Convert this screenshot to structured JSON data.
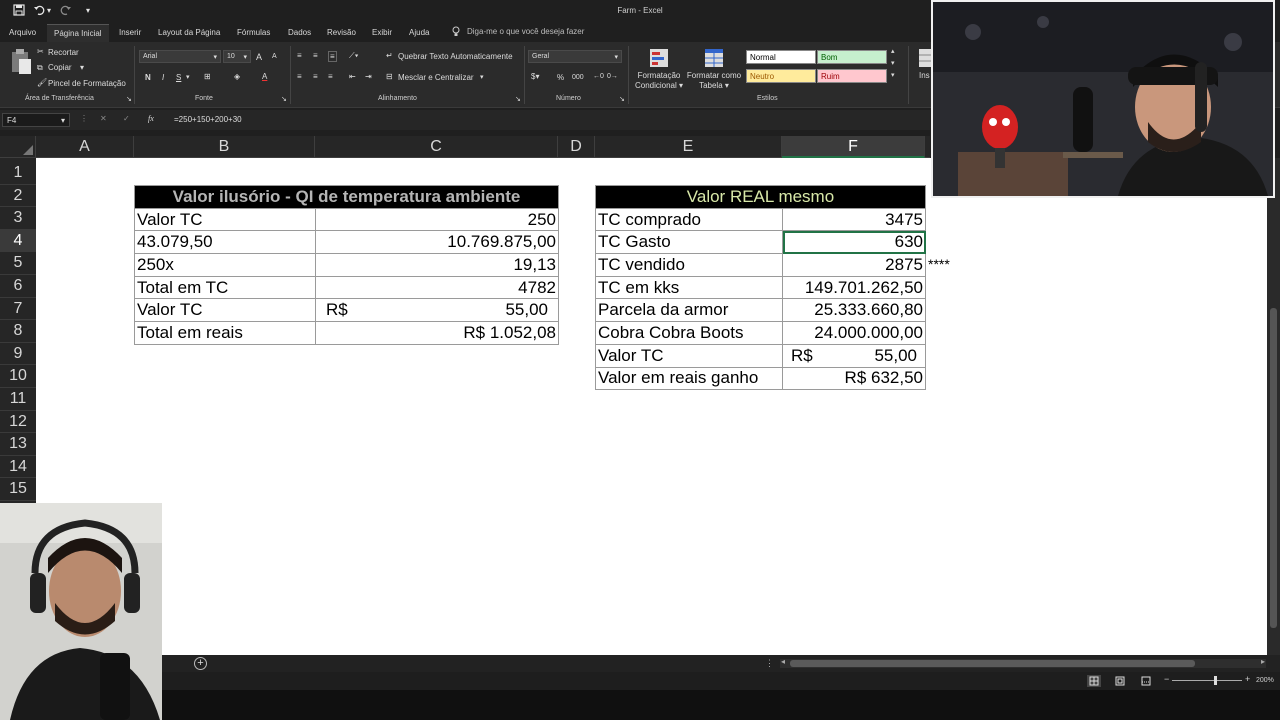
{
  "app": {
    "file_name": "Farm",
    "app_name": "Excel",
    "title": "Farm  -  Excel"
  },
  "quick_access": {
    "save_icon": "save-icon",
    "undo_icon": "undo-icon",
    "redo_icon": "redo-icon",
    "customize_icon": "customize-icon"
  },
  "tabs": [
    {
      "label": "Arquivo"
    },
    {
      "label": "Página Inicial",
      "active": true
    },
    {
      "label": "Inserir"
    },
    {
      "label": "Layout da Página"
    },
    {
      "label": "Fórmulas"
    },
    {
      "label": "Dados"
    },
    {
      "label": "Revisão"
    },
    {
      "label": "Exibir"
    },
    {
      "label": "Ajuda"
    }
  ],
  "tell_me": "Diga-me o que você deseja fazer",
  "ribbon": {
    "clipboard": {
      "cut": "Recortar",
      "copy": "Copiar",
      "format_painter": "Pincel de Formatação",
      "label": "Área de Transferência"
    },
    "font": {
      "name": "Arial",
      "size": "10",
      "bold": "N",
      "italic": "I",
      "underline": "S",
      "grow": "A",
      "shrink": "A",
      "color": "A",
      "label": "Fonte"
    },
    "alignment": {
      "wrap": "Quebrar Texto Automaticamente",
      "merge": "Mesclar e Centralizar",
      "label": "Alinhamento"
    },
    "number": {
      "format": "Geral",
      "percent": "%",
      "thousands": "000",
      "label": "Número"
    },
    "styles": {
      "conditional": [
        "Formatação",
        "Condicional"
      ],
      "table": [
        "Formatar como",
        "Tabela"
      ],
      "normal": "Normal",
      "good": "Bom",
      "neutral": "Neutro",
      "bad": "Ruim",
      "label": "Estilos"
    },
    "insert_partial": "Ins"
  },
  "formula_bar": {
    "name_box": "F4",
    "fx": "fx",
    "formula": "=250+150+200+30"
  },
  "columns": [
    "A",
    "B",
    "C",
    "D",
    "E",
    "F"
  ],
  "selected_column": "F",
  "rows": [
    "1",
    "2",
    "3",
    "4",
    "5",
    "6",
    "7",
    "8",
    "9",
    "10",
    "11",
    "12",
    "13",
    "14",
    "15"
  ],
  "selected_row": "4",
  "table_left": {
    "header": "Valor ilusório - QI de temperatura ambiente",
    "rows": [
      {
        "label": "Valor TC",
        "currency": "",
        "value": "250"
      },
      {
        "label": "43.079,50",
        "currency": "",
        "value": "10.769.875,00"
      },
      {
        "label": "250x",
        "currency": "",
        "value": "19,13"
      },
      {
        "label": "Total em TC",
        "currency": "",
        "value": "4782"
      },
      {
        "label": "Valor TC",
        "currency": "R$",
        "value": "55,00"
      },
      {
        "label": "Total em reais",
        "currency": "",
        "value": "R$ 1.052,08"
      }
    ]
  },
  "table_right": {
    "header": "Valor REAL mesmo",
    "rows": [
      {
        "label": "TC comprado",
        "currency": "",
        "value": "3475"
      },
      {
        "label": "TC Gasto",
        "currency": "",
        "value": "630"
      },
      {
        "label": "TC vendido",
        "currency": "",
        "value": "2875"
      },
      {
        "label": "TC em kks",
        "currency": "",
        "value": "149.701.262,50"
      },
      {
        "label": "Parcela da armor",
        "currency": "",
        "value": "25.333.660,80"
      },
      {
        "label": "Cobra Cobra Boots",
        "currency": "",
        "value": "24.000.000,00"
      },
      {
        "label": "Valor TC",
        "currency": "R$",
        "value": "55,00"
      },
      {
        "label": "Valor em reais ganho",
        "currency": "",
        "value": "R$ 632,50"
      }
    ]
  },
  "stars_note": "****",
  "status": {
    "zoom": "200%"
  },
  "colors": {
    "excel_green": "#217346",
    "header_black": "#000000",
    "good_fill": "#c6efce",
    "neutral_fill": "#ffeb9c",
    "bad_fill": "#ffc7ce"
  }
}
